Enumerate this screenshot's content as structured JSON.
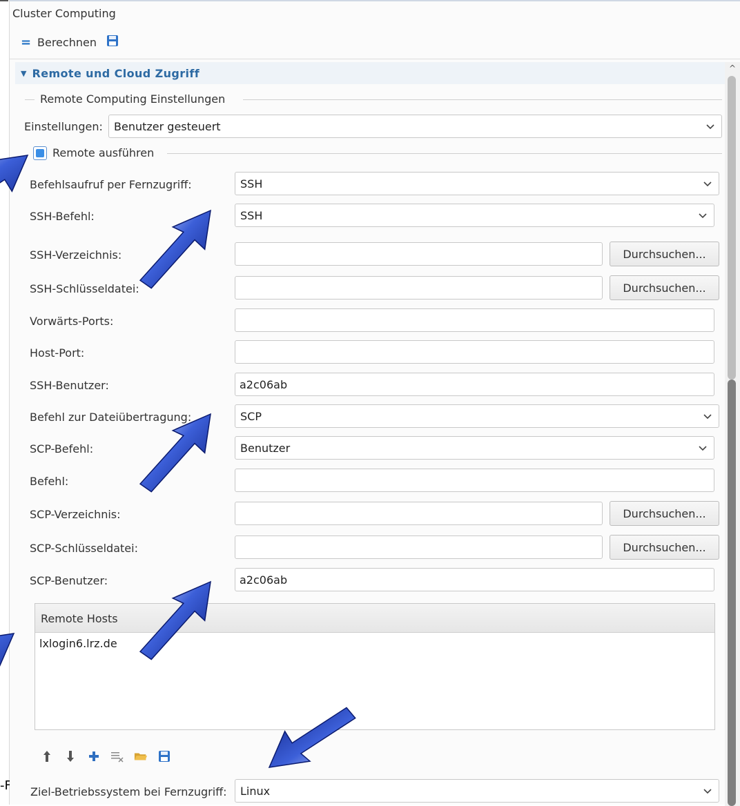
{
  "panel": {
    "title": "Cluster Computing"
  },
  "toolbar": {
    "calc_label": "Berechnen"
  },
  "section": {
    "title": "Remote und Cloud Zugriff"
  },
  "group": {
    "legend": "Remote Computing Einstellungen"
  },
  "settings": {
    "label": "Einstellungen:",
    "value": "Benutzer gesteuert"
  },
  "remote": {
    "checkbox_label": "Remote ausführen",
    "checked": true
  },
  "fields": {
    "befehlsaufruf": {
      "label": "Befehlsaufruf per Fernzugriff:",
      "value": "SSH"
    },
    "ssh_befehl": {
      "label": "SSH-Befehl:",
      "value": "SSH"
    },
    "ssh_verzeichnis": {
      "label": "SSH-Verzeichnis:",
      "value": ""
    },
    "ssh_schluesseldatei": {
      "label": "SSH-Schlüsseldatei:",
      "value": ""
    },
    "vorwaerts_ports": {
      "label": "Vorwärts-Ports:",
      "value": ""
    },
    "host_port": {
      "label": "Host-Port:",
      "value": ""
    },
    "ssh_benutzer": {
      "label": "SSH-Benutzer:",
      "value": "a2c06ab"
    },
    "dateiuebertragung": {
      "label": "Befehl zur Dateiübertragung:",
      "value": "SCP"
    },
    "scp_befehl": {
      "label": "SCP-Befehl:",
      "value": "Benutzer"
    },
    "befehl": {
      "label": "Befehl:",
      "value": ""
    },
    "scp_verzeichnis": {
      "label": "SCP-Verzeichnis:",
      "value": ""
    },
    "scp_schluesseldatei": {
      "label": "SCP-Schlüsseldatei:",
      "value": ""
    },
    "scp_benutzer": {
      "label": "SCP-Benutzer:",
      "value": "a2c06ab"
    },
    "ziel_os": {
      "label": "Ziel-Betriebssystem bei Fernzugriff:",
      "value": "Linux"
    }
  },
  "browse_label": "Durchsuchen...",
  "hosts": {
    "header": "Remote Hosts",
    "items": [
      "lxlogin6.lrz.de"
    ]
  },
  "edge_text": "-F",
  "colors": {
    "accent": "#2d6aa3",
    "arrow": "#1f3fb3",
    "check": "#3a8ee6"
  }
}
